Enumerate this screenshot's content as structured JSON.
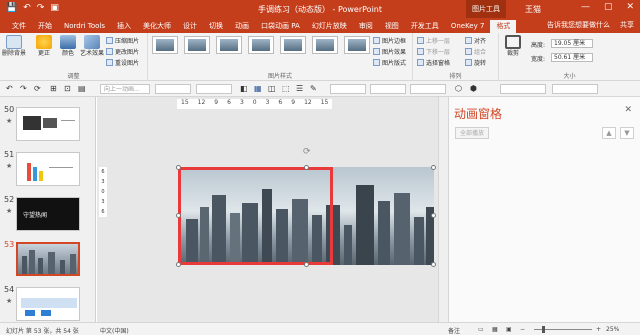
{
  "window": {
    "title": "手调练习（动态版） - PowerPoint",
    "context_tab": "图片工具",
    "user": "王猫",
    "qat": [
      "💾",
      "↶",
      "↷",
      "▣"
    ],
    "controls": [
      "—",
      "▢",
      "✕"
    ]
  },
  "tabs": {
    "items": [
      "文件",
      "开始",
      "Nordri Tools",
      "插入",
      "美化大师",
      "设计",
      "切换",
      "动画",
      "口袋动画 PA",
      "幻灯片放映",
      "审阅",
      "视图",
      "开发工具",
      "OneKey 7",
      "格式"
    ],
    "active_index": 14,
    "tell_me": "告诉我您想要做什么",
    "share": "共享"
  },
  "ribbon": {
    "groups": [
      "调整",
      "图片样式",
      "排列",
      "大小"
    ],
    "remove_bg": "删除背景",
    "corrections": "更正",
    "color": "颜色",
    "artistic": "艺术效果",
    "compress": "压缩图片",
    "change": "更改图片",
    "reset": "重设图片",
    "border": "图片边框",
    "effects": "图片效果",
    "layout": "图片版式",
    "bring_forward": "上移一层",
    "send_backward": "下移一层",
    "selection_pane": "选择窗格",
    "align": "对齐",
    "group": "组合",
    "rotate": "旋转",
    "crop": "裁剪",
    "height_label": "高度:",
    "height_value": "19.05 厘米",
    "width_label": "宽度:",
    "width_value": "50.61 厘米"
  },
  "toolbar2": {
    "animation_dropdown": "向上一动画...",
    "icons": [
      "↶",
      "↷",
      "⟳",
      "⊞",
      "⊡",
      "▤",
      "◧",
      "▦",
      "◫",
      "⬚",
      "☰",
      "✎",
      "⬡",
      "⬢"
    ]
  },
  "ruler": {
    "h_ticks": [
      "15",
      "12",
      "9",
      "6",
      "3",
      "0",
      "3",
      "6",
      "9",
      "12",
      "15"
    ],
    "v_ticks": [
      "6",
      "3",
      "0",
      "3",
      "6"
    ]
  },
  "slides": [
    {
      "num": "50",
      "star": "★"
    },
    {
      "num": "51",
      "star": "★"
    },
    {
      "num": "52",
      "star": "★"
    },
    {
      "num": "53",
      "star": ""
    },
    {
      "num": "54",
      "star": "★"
    }
  ],
  "slide52_text": "守望热闻",
  "anim_pane": {
    "title": "动画窗格",
    "play_all": "全部播放",
    "close": "✕",
    "up": "▲",
    "down": "▼"
  },
  "status": {
    "slide_info": "幻灯片 第 53 张，共 54 张",
    "language": "中文(中国)",
    "notes": "备注",
    "zoom": "25%"
  }
}
